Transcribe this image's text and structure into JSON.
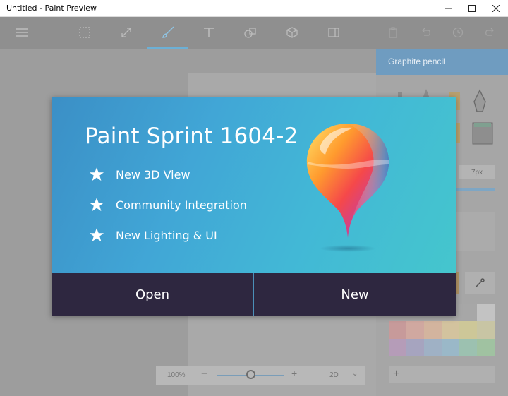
{
  "window": {
    "title": "Untitled - Paint Preview",
    "controls": [
      "minimize",
      "maximize",
      "close"
    ]
  },
  "toolbar": {
    "left": [
      "hamburger-menu-icon"
    ],
    "tools": [
      "select-icon",
      "crop-resize-icon",
      "brush-icon",
      "text-icon",
      "stickers-icon",
      "3d-object-icon",
      "3d-view-icon"
    ],
    "active_tool": "brush-icon",
    "right": [
      "paste-icon",
      "undo-icon",
      "history-icon",
      "redo-icon"
    ]
  },
  "right_panel": {
    "header": "Graphite pencil",
    "size_value": "7px",
    "palette": [
      "#c79a9a",
      "#d0a8a0",
      "#d3b49e",
      "#d3c39e",
      "#cdc798",
      "#c8c5a4",
      "#b59cb8",
      "#a6a4bf",
      "#9fb1c5",
      "#9ab8c8",
      "#9cc1b0",
      "#a0c2a1"
    ],
    "add_label": "+"
  },
  "zoom": {
    "value": "100%",
    "minus": "−",
    "plus": "+",
    "level": 0.5,
    "mode": "2D"
  },
  "dialog": {
    "title": "Paint Sprint 1604-2",
    "features": [
      "New 3D View",
      "Community Integration",
      "New Lighting & UI"
    ],
    "open_label": "Open",
    "new_label": "New"
  }
}
